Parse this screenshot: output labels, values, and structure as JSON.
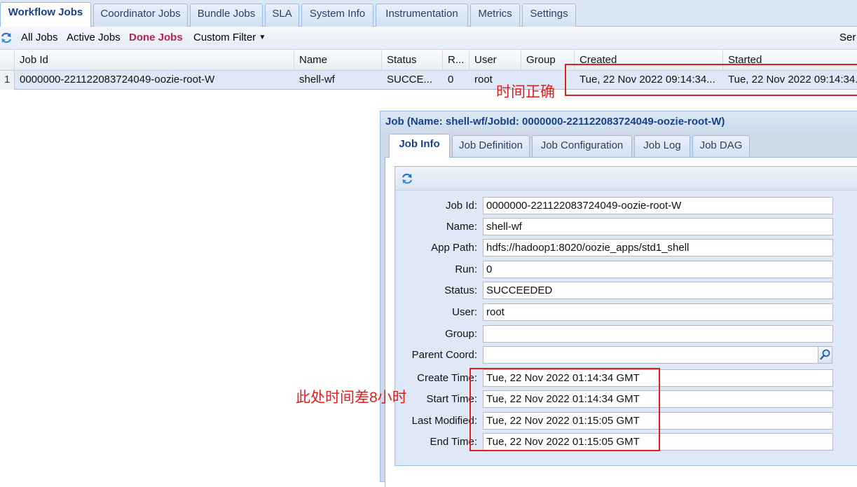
{
  "tabs": [
    "Workflow Jobs",
    "Coordinator Jobs",
    "Bundle Jobs",
    "SLA",
    "System Info",
    "Instrumentation",
    "Metrics",
    "Settings"
  ],
  "toolbar": {
    "all_jobs": "All Jobs",
    "active_jobs": "Active Jobs",
    "done_jobs": "Done Jobs",
    "custom_filter": "Custom Filter",
    "server_cut": "Ser"
  },
  "grid": {
    "headers": [
      "Job Id",
      "Name",
      "Status",
      "R...",
      "User",
      "Group",
      "Created",
      "Started"
    ],
    "row": {
      "num": "1",
      "job_id": "0000000-221122083724049-oozie-root-W",
      "name": "shell-wf",
      "status": "SUCCE...",
      "run": "0",
      "user": "root",
      "group": "",
      "created": "Tue, 22 Nov 2022 09:14:34...",
      "started": "Tue, 22 Nov 2022 09:14:34..."
    }
  },
  "annotations": {
    "correct_time": "时间正确",
    "time_diff": "此处时间差8小时",
    "color": "#e02020"
  },
  "dialog": {
    "title": "Job (Name: shell-wf/JobId: 0000000-221122083724049-oozie-root-W)",
    "tabs": [
      "Job Info",
      "Job Definition",
      "Job Configuration",
      "Job Log",
      "Job DAG"
    ],
    "fields": {
      "job_id": {
        "label": "Job Id:",
        "value": "0000000-221122083724049-oozie-root-W"
      },
      "name": {
        "label": "Name:",
        "value": "shell-wf"
      },
      "app_path": {
        "label": "App Path:",
        "value": "hdfs://hadoop1:8020/oozie_apps/std1_shell"
      },
      "run": {
        "label": "Run:",
        "value": "0"
      },
      "status": {
        "label": "Status:",
        "value": "SUCCEEDED"
      },
      "user": {
        "label": "User:",
        "value": "root"
      },
      "group": {
        "label": "Group:",
        "value": ""
      },
      "parent_coord": {
        "label": "Parent Coord:",
        "value": ""
      },
      "create_time": {
        "label": "Create Time:",
        "value": "Tue, 22 Nov 2022 01:14:34 GMT"
      },
      "start_time": {
        "label": "Start Time:",
        "value": "Tue, 22 Nov 2022 01:14:34 GMT"
      },
      "last_modified": {
        "label": "Last Modified:",
        "value": "Tue, 22 Nov 2022 01:15:05 GMT"
      },
      "end_time": {
        "label": "End Time:",
        "value": "Tue, 22 Nov 2022 01:15:05 GMT"
      }
    }
  },
  "icons": [
    "refresh-icon",
    "dropdown-arrow-icon",
    "search-icon"
  ],
  "colors": {
    "accent": "#15428b",
    "active_filter": "#b6254d",
    "row_selected": "#dfe8f6"
  }
}
